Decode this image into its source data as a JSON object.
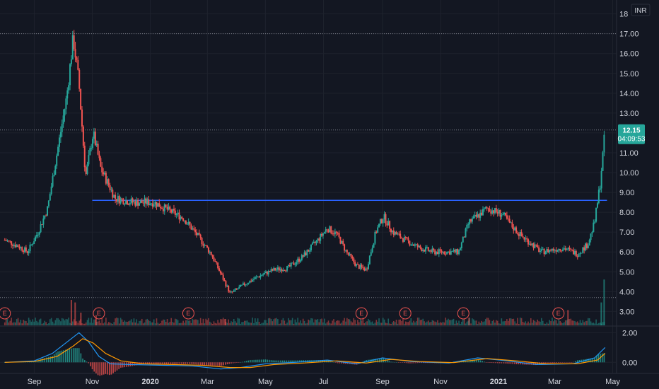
{
  "currency_label": "INR",
  "last_price_label": "12.15",
  "countdown_label": "04:09:53",
  "colors": {
    "background": "#131722",
    "grid": "#1e222d",
    "up": "#26a69a",
    "down": "#ef5350",
    "resistance": "#2962ff",
    "macd_line": "#2196f3",
    "signal_line": "#ff9800",
    "axis_text": "#d1d4dc"
  },
  "chart_data": [
    {
      "type": "candlestick",
      "title": "",
      "x_tick_labels": [
        "Sep",
        "Nov",
        "2020",
        "Mar",
        "May",
        "Jul",
        "Sep",
        "Nov",
        "2021",
        "Mar",
        "May"
      ],
      "y_tick_labels": [
        "3.00",
        "4.00",
        "5.00",
        "6.00",
        "7.00",
        "8.00",
        "9.00",
        "10.00",
        "11.00",
        "12.00",
        "13.00",
        "14.00",
        "15.00",
        "16.00",
        "17.00",
        "18"
      ],
      "ylim": [
        2.3,
        18.2
      ],
      "scale": "linear",
      "grid": true,
      "last_price": 12.15,
      "horizontal_levels": [
        17.0,
        12.15,
        3.7
      ],
      "resistance_line": {
        "value": 8.6,
        "from": "2019-11-01",
        "to": "2021-04-25"
      },
      "series": [
        {
          "label_points": [
            [
              "2019-08-01",
              6.6
            ],
            [
              "2019-08-15",
              6.3
            ],
            [
              "2019-08-25",
              6.0
            ],
            [
              "2019-09-05",
              7.0
            ],
            [
              "2019-09-15",
              8.2
            ],
            [
              "2019-09-25",
              11.0
            ],
            [
              "2019-10-05",
              13.8
            ],
            [
              "2019-10-12",
              16.8
            ],
            [
              "2019-10-18",
              14.5
            ],
            [
              "2019-10-25",
              9.8
            ],
            [
              "2019-11-02",
              12.0
            ],
            [
              "2019-11-10",
              10.2
            ],
            [
              "2019-11-25",
              8.7
            ],
            [
              "2019-12-15",
              8.5
            ],
            [
              "2020-01-05",
              8.5
            ],
            [
              "2020-01-20",
              8.1
            ],
            [
              "2020-02-05",
              7.7
            ],
            [
              "2020-02-20",
              6.8
            ],
            [
              "2020-03-05",
              5.9
            ],
            [
              "2020-03-15",
              4.9
            ],
            [
              "2020-03-25",
              3.9
            ],
            [
              "2020-04-10",
              4.4
            ],
            [
              "2020-04-25",
              4.8
            ],
            [
              "2020-05-10",
              5.1
            ],
            [
              "2020-05-25",
              5.2
            ],
            [
              "2020-06-10",
              5.8
            ],
            [
              "2020-06-25",
              6.6
            ],
            [
              "2020-07-05",
              7.2
            ],
            [
              "2020-07-15",
              6.9
            ],
            [
              "2020-07-25",
              6.0
            ],
            [
              "2020-08-05",
              5.3
            ],
            [
              "2020-08-15",
              5.1
            ],
            [
              "2020-08-25",
              7.0
            ],
            [
              "2020-09-02",
              7.8
            ],
            [
              "2020-09-12",
              7.0
            ],
            [
              "2020-09-25",
              6.6
            ],
            [
              "2020-10-10",
              6.2
            ],
            [
              "2020-10-25",
              6.0
            ],
            [
              "2020-11-10",
              6.0
            ],
            [
              "2020-11-20",
              6.0
            ],
            [
              "2020-12-01",
              7.5
            ],
            [
              "2020-12-10",
              7.8
            ],
            [
              "2020-12-20",
              8.2
            ],
            [
              "2021-01-05",
              7.9
            ],
            [
              "2021-01-15",
              7.3
            ],
            [
              "2021-01-25",
              6.8
            ],
            [
              "2021-02-05",
              6.4
            ],
            [
              "2021-02-15",
              6.0
            ],
            [
              "2021-02-25",
              6.1
            ],
            [
              "2021-03-10",
              6.2
            ],
            [
              "2021-03-25",
              5.9
            ],
            [
              "2021-04-05",
              6.4
            ],
            [
              "2021-04-12",
              7.5
            ],
            [
              "2021-04-18",
              9.5
            ],
            [
              "2021-04-23",
              12.15
            ]
          ]
        }
      ]
    },
    {
      "type": "bar",
      "title": "",
      "description_values": "volume histogram",
      "spikes": [
        [
          "2019-10-10",
          1.0
        ],
        [
          "2019-10-14",
          0.9
        ],
        [
          "2019-10-20",
          0.5
        ],
        [
          "2019-11-05",
          0.4
        ],
        [
          "2020-03-20",
          0.25
        ],
        [
          "2020-12-01",
          0.3
        ],
        [
          "2021-03-15",
          0.6
        ],
        [
          "2021-04-19",
          0.9
        ],
        [
          "2021-04-22",
          1.8
        ]
      ]
    },
    {
      "type": "line",
      "title": "",
      "y_tick_labels": [
        "2.00",
        "0.00"
      ],
      "ylim": [
        -0.75,
        2.4
      ],
      "series": [
        {
          "label_points": [
            [
              "2019-08-01",
              0.0
            ],
            [
              "2019-09-01",
              0.1
            ],
            [
              "2019-09-20",
              0.6
            ],
            [
              "2019-10-10",
              1.6
            ],
            [
              "2019-10-18",
              2.0
            ],
            [
              "2019-10-28",
              1.4
            ],
            [
              "2019-11-08",
              0.4
            ],
            [
              "2019-11-20",
              -0.1
            ],
            [
              "2019-12-10",
              -0.15
            ],
            [
              "2020-01-15",
              -0.2
            ],
            [
              "2020-02-15",
              -0.25
            ],
            [
              "2020-03-15",
              -0.45
            ],
            [
              "2020-04-05",
              -0.35
            ],
            [
              "2020-05-01",
              -0.1
            ],
            [
              "2020-06-01",
              0.0
            ],
            [
              "2020-07-05",
              0.15
            ],
            [
              "2020-08-05",
              -0.1
            ],
            [
              "2020-09-01",
              0.3
            ],
            [
              "2020-10-01",
              0.05
            ],
            [
              "2020-11-10",
              -0.05
            ],
            [
              "2020-12-10",
              0.3
            ],
            [
              "2021-01-10",
              0.1
            ],
            [
              "2021-02-10",
              -0.15
            ],
            [
              "2021-03-20",
              -0.1
            ],
            [
              "2021-04-12",
              0.3
            ],
            [
              "2021-04-23",
              1.0
            ]
          ]
        },
        {
          "label_points": [
            [
              "2019-08-01",
              0.0
            ],
            [
              "2019-09-01",
              0.05
            ],
            [
              "2019-09-25",
              0.4
            ],
            [
              "2019-10-12",
              1.1
            ],
            [
              "2019-10-22",
              1.6
            ],
            [
              "2019-11-02",
              1.3
            ],
            [
              "2019-11-15",
              0.6
            ],
            [
              "2019-12-01",
              0.1
            ],
            [
              "2019-12-25",
              -0.1
            ],
            [
              "2020-01-25",
              -0.15
            ],
            [
              "2020-02-25",
              -0.2
            ],
            [
              "2020-03-25",
              -0.35
            ],
            [
              "2020-04-15",
              -0.35
            ],
            [
              "2020-05-10",
              -0.15
            ],
            [
              "2020-06-10",
              -0.05
            ],
            [
              "2020-07-15",
              0.1
            ],
            [
              "2020-08-15",
              -0.05
            ],
            [
              "2020-09-10",
              0.2
            ],
            [
              "2020-10-10",
              0.05
            ],
            [
              "2020-11-15",
              -0.02
            ],
            [
              "2020-12-20",
              0.25
            ],
            [
              "2021-01-20",
              0.1
            ],
            [
              "2021-02-20",
              -0.1
            ],
            [
              "2021-03-25",
              -0.1
            ],
            [
              "2021-04-15",
              0.15
            ],
            [
              "2021-04-23",
              0.6
            ]
          ]
        }
      ]
    }
  ],
  "earnings_markers": [
    {
      "date": "2019-08-01",
      "label": "E"
    },
    {
      "date": "2019-11-08",
      "label": "E"
    },
    {
      "date": "2020-02-10",
      "label": "E"
    },
    {
      "date": "2020-08-10",
      "label": "E"
    },
    {
      "date": "2020-09-25",
      "label": "E"
    },
    {
      "date": "2020-11-25",
      "label": "E"
    },
    {
      "date": "2021-03-05",
      "label": "E"
    }
  ]
}
